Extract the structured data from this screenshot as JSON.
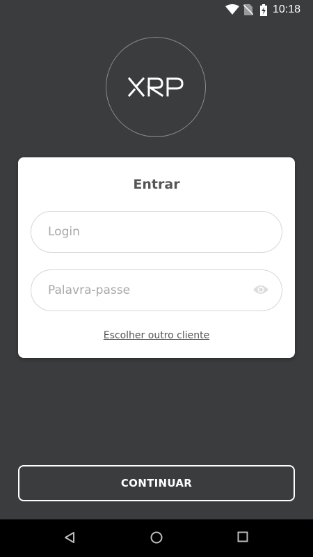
{
  "status_bar": {
    "time": "10:18",
    "icons": [
      "wifi-icon",
      "no-sim-icon",
      "battery-charging-icon"
    ]
  },
  "logo": {
    "text": "XRP"
  },
  "login_card": {
    "title": "Entrar",
    "login_placeholder": "Login",
    "password_placeholder": "Palavra-passe",
    "password_toggle_icon": "eye-icon",
    "choose_client_link": "Escolher outro cliente"
  },
  "continue_button": {
    "label": "CONTINUAR"
  },
  "nav_bar": {
    "icons": [
      "back-icon",
      "home-icon",
      "recents-icon"
    ]
  },
  "colors": {
    "background": "#3b3c3e",
    "card": "#ffffff",
    "text": "#555555",
    "placeholder": "#a7a7a7"
  }
}
